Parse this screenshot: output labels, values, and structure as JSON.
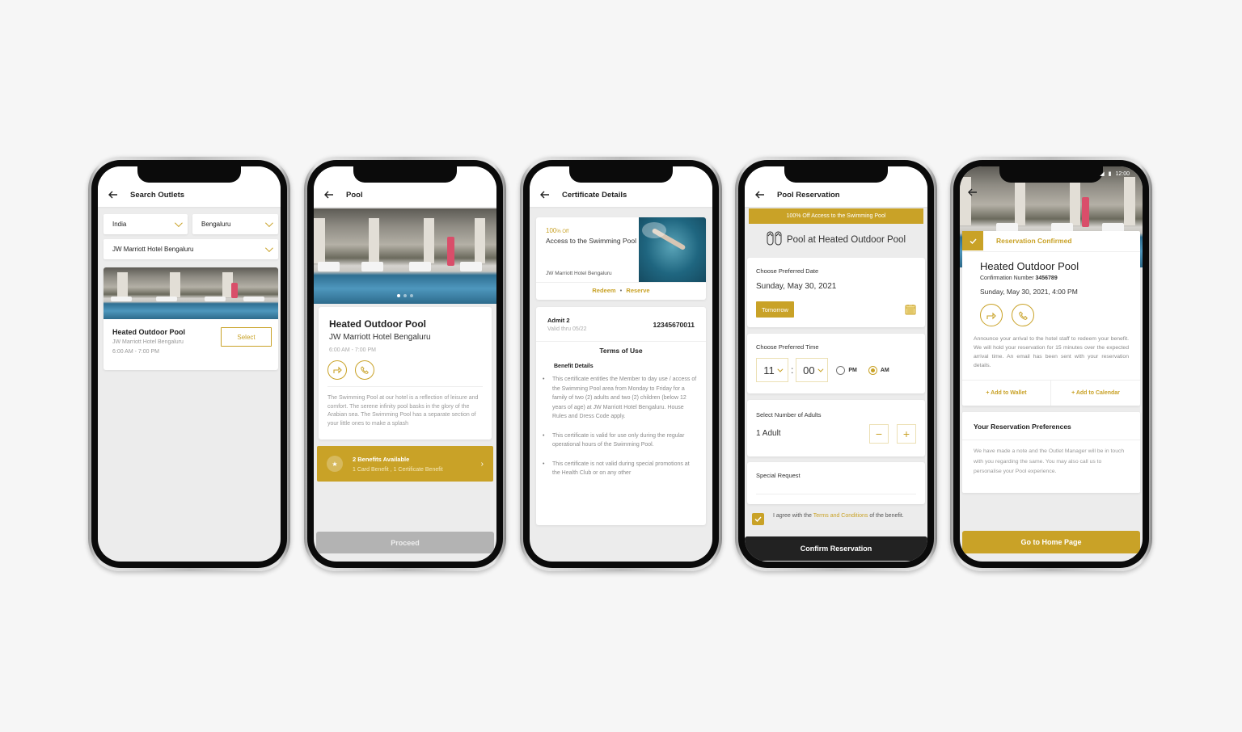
{
  "colors": {
    "accent": "#c9a227",
    "background": "#f6f6f6",
    "screen_bg": "#ececec",
    "dark_button": "#222222",
    "disabled_button": "#b3b3b3"
  },
  "phone1": {
    "header": {
      "title": "Search Outlets",
      "back_icon": "arrow-left-icon"
    },
    "country": {
      "value": "India"
    },
    "city": {
      "value": "Bengaluru"
    },
    "hotel": {
      "value": "JW Marriott Hotel Bengaluru"
    },
    "outlet": {
      "name": "Heated Outdoor Pool",
      "hotel": "JW Marriott Hotel Bengaluru",
      "hours": "6:00 AM - 7:00 PM",
      "select_label": "Select"
    }
  },
  "phone2": {
    "header": {
      "title": "Pool",
      "back_icon": "arrow-left-icon"
    },
    "outlet": {
      "name": "Heated Outdoor Pool",
      "hotel": "JW Marriott Hotel Bengaluru",
      "hours": "6:00 AM - 7:00 PM"
    },
    "description": "The Swimming Pool at our hotel is a reflection of leisure and comfort. The serene infinity pool basks in the glory of the Arabian sea. The Swimming Pool has a separate section of your little ones to make a splash",
    "benefits": {
      "title": "2 Benefits Available",
      "subtitle": "1 Card Benefit , 1 Certificate Benefit"
    },
    "proceed_label": "Proceed"
  },
  "phone3": {
    "header": {
      "title": "Certificate Details",
      "back_icon": "arrow-left-icon"
    },
    "certificate": {
      "discount_value": "100",
      "discount_unit": "% Off",
      "title": "Access to the Swimming Pool",
      "hotel": "JW Marriott Hotel Bengaluru",
      "redeem_label": "Redeem",
      "reserve_label": "Reserve",
      "separator": "•"
    },
    "admit": {
      "label": "Admit 2",
      "valid": "Valid thru 05/22",
      "number": "12345670011"
    },
    "terms": {
      "title": "Terms of Use",
      "subtitle": "Benefit Details",
      "items": [
        "This certificate entitles the Member to day use / access of the Swimming Pool area from Monday to Friday for a family of two (2) adults and two (2) children (below 12 years of age) at JW Marriott Hotel Bengaluru. House Rules and Dress Code apply.",
        "This certificate is valid for use only during the regular operational hours of the Swimming Pool.",
        "This certificate is not valid during special promotions at the Health Club or on any other"
      ]
    }
  },
  "phone4": {
    "header": {
      "title": "Pool Reservation",
      "back_icon": "arrow-left-icon"
    },
    "banner": "100% Off Access to the Swimming Pool",
    "venue": "Pool at Heated Outdoor Pool",
    "date": {
      "label": "Choose Preferred Date",
      "value": "Sunday, May 30, 2021",
      "tomorrow_label": "Tomorrow"
    },
    "time": {
      "label": "Choose Preferred Time",
      "hour": "11",
      "minute": "00",
      "separator": ":",
      "pm_label": "PM",
      "am_label": "AM",
      "selected": "AM"
    },
    "adults": {
      "label": "Select Number of Adults",
      "value": "1 Adult",
      "minus": "−",
      "plus": "+"
    },
    "special_request": {
      "label": "Special Request",
      "value": ""
    },
    "agree": {
      "checked": true,
      "prefix": "I agree with the ",
      "link": "Terms and Conditions",
      "suffix": " of the benefit."
    },
    "confirm_label": "Confirm Reservation"
  },
  "phone5": {
    "status_bar": {
      "time": "12:00"
    },
    "confirmed_label": "Reservation Confirmed",
    "outlet": "Heated Outdoor Pool",
    "confirmation": {
      "label": "Confirmation Number ",
      "number": "3456789"
    },
    "datetime": "Sunday, May 30, 2021, 4:00 PM",
    "note": "Announce your arrival to the hotel staff to redeem your benefit. We will hold your reservation for 15 minutes over the expected arrival time. An email has been sent with your reservation details.",
    "add_wallet": "+ Add to Wallet",
    "add_calendar": "+ Add to Calendar",
    "preferences": {
      "title": "Your Reservation Preferences",
      "text": "We have made a note and the Outlet Manager will be in touch with you regarding the same. You may also call us to personalise your Pool experience."
    },
    "home_label": "Go to Home Page"
  }
}
